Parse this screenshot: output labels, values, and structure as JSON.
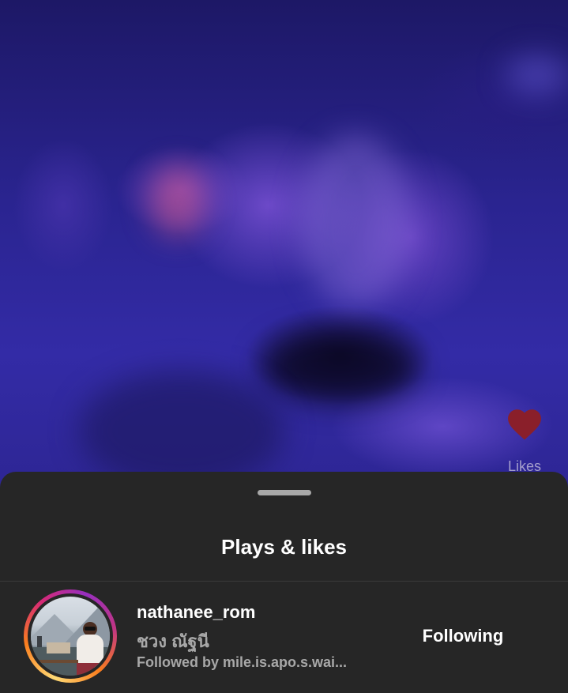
{
  "video": {
    "like_label": "Likes",
    "like_color": "#8a1f2a"
  },
  "sheet": {
    "title": "Plays & likes"
  },
  "users": [
    {
      "username": "nathanee_rom",
      "full_name": "ชวง ณัฐนี",
      "followed_by": "Followed by mile.is.apo.s.wai...",
      "follow_label": "Following"
    }
  ],
  "colors": {
    "sheet_bg": "#262626",
    "text_primary": "#ffffff",
    "text_secondary": "#a8a8a8"
  }
}
